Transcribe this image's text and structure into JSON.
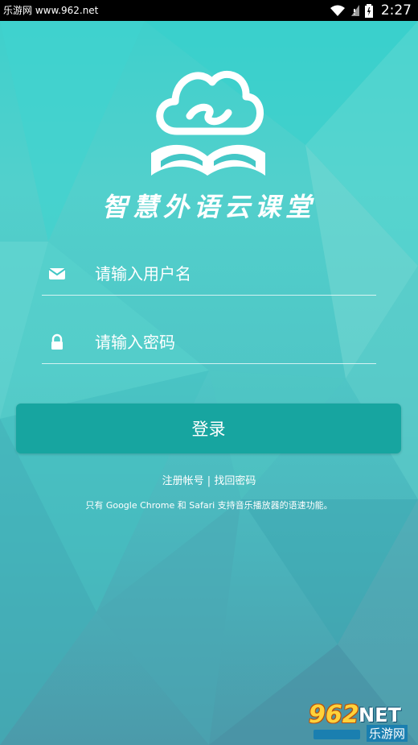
{
  "status_bar": {
    "left_text": "乐游网 www.962.net",
    "time": "2:27",
    "icons": [
      "wifi-icon",
      "signal-icon",
      "battery-icon"
    ]
  },
  "app": {
    "title": "智慧外语云课堂",
    "logo": "cloud-book-logo"
  },
  "form": {
    "username_placeholder": "请输入用户名",
    "password_placeholder": "请输入密码",
    "login_label": "登录"
  },
  "links": {
    "register": "注册帐号",
    "separator": " | ",
    "forgot": "找回密码"
  },
  "note": "只有 Google Chrome 和 Safari 支持音乐播放器的语速功能。",
  "watermark": {
    "number": "962",
    "net": "NET",
    "cn": "乐游网"
  },
  "colors": {
    "background": "#43c7c6",
    "button": "#17a5a0"
  }
}
